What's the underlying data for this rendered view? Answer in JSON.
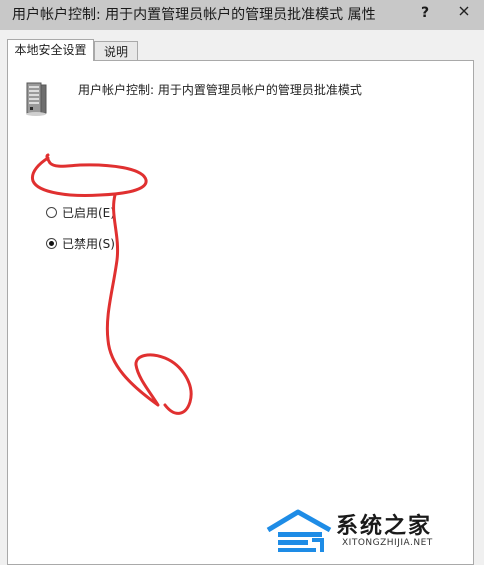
{
  "window": {
    "title": "用户帐户控制: 用于内置管理员帐户的管理员批准模式 属性",
    "help_label": "?",
    "close_icon": "close-icon"
  },
  "tabs": [
    {
      "label": "本地安全设置",
      "active": true
    },
    {
      "label": "说明",
      "active": false
    }
  ],
  "policy": {
    "icon": "server-icon",
    "title": "用户帐户控制: 用于内置管理员帐户的管理员批准模式"
  },
  "options": [
    {
      "label": "已启用(E)",
      "checked": false
    },
    {
      "label": "已禁用(S)",
      "checked": true
    }
  ],
  "annotation": {
    "color": "#e03030",
    "shape": "freehand red circle and arrow"
  },
  "watermark": {
    "cn": "系统之家",
    "en": "XITONGZHIJIA.NET"
  },
  "colors": {
    "titlebar": "#c8c8c8",
    "client": "#f0f0f0",
    "panel": "#ffffff",
    "logo_blue": "#1e8ce6"
  }
}
